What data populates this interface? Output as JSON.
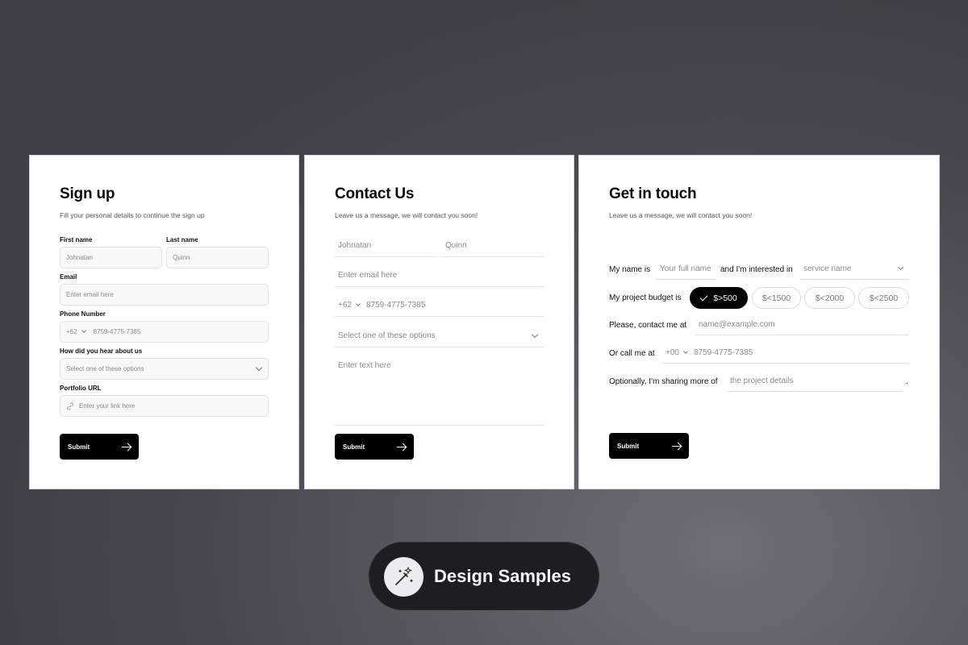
{
  "signup": {
    "title": "Sign up",
    "subtitle": "Fill your personal details to continue the sign up",
    "first_name_label": "First name",
    "first_name_placeholder": "Johnatan",
    "last_name_label": "Last name",
    "last_name_placeholder": "Quinn",
    "email_label": "Email",
    "email_placeholder": "Enter email here",
    "phone_label": "Phone Number",
    "phone_code": "+62",
    "phone_placeholder": "8759-4775-7385",
    "source_label": "How did you hear about us",
    "source_placeholder": "Select one of these options",
    "portfolio_label": "Portfolio URL",
    "portfolio_placeholder": "Enter your link here",
    "submit_label": "Submit"
  },
  "contact": {
    "title": "Contact Us",
    "subtitle": "Leave us a message, we will contact you soon!",
    "first_name_placeholder": "Johnatan",
    "last_name_placeholder": "Quinn",
    "email_placeholder": "Enter email here",
    "phone_code": "+62",
    "phone_placeholder": "8759-4775-7385",
    "select_placeholder": "Select one of these options",
    "message_placeholder": "Enter text here",
    "submit_label": "Submit"
  },
  "touch": {
    "title": "Get in touch",
    "subtitle": "Leave us a message, we will contact you soon!",
    "name_prefix": "My name is",
    "name_placeholder": "Your full name",
    "interest_text": "and I'm interested in",
    "service_placeholder": "service name",
    "budget_text": "My project budget is",
    "budget_options": [
      "$>500",
      "$<1500",
      "$<2000",
      "$<2500"
    ],
    "budget_selected": "$>500",
    "contact_text": "Please, contact me at",
    "email_placeholder": "name@example.com",
    "call_text": "Or call me at",
    "phone_code": "+00",
    "phone_placeholder": "8759-4775-7385",
    "sharing_text": "Optionally, I'm sharing more of",
    "details_placeholder": "the project details",
    "period": ".",
    "submit_label": "Submit"
  },
  "badge": {
    "label": "Design Samples",
    "icon": "magic-wand-icon"
  }
}
